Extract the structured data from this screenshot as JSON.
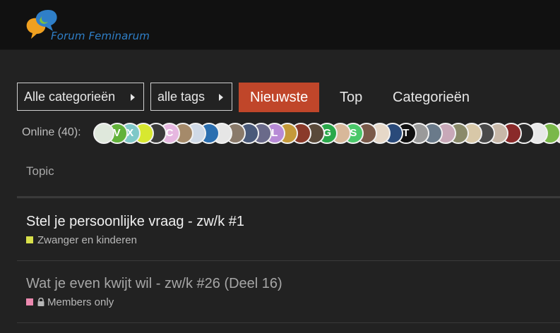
{
  "header": {
    "logo_text": "Forum Feminarum"
  },
  "nav": {
    "categories_dropdown": "Alle categorieën",
    "tags_dropdown": "alle tags",
    "tabs": [
      "Nieuwste",
      "Top",
      "Categorieën"
    ],
    "active_tab": "Nieuwste"
  },
  "online": {
    "label": "Online (40):",
    "avatars": [
      {
        "letter": "",
        "color": "#dfe8dc"
      },
      {
        "letter": "V",
        "color": "#62b23a"
      },
      {
        "letter": "X",
        "color": "#7fc8c8"
      },
      {
        "letter": "",
        "color": "#d8e830"
      },
      {
        "letter": "",
        "color": "#3b3b3b"
      },
      {
        "letter": "C",
        "color": "#e6b7e0"
      },
      {
        "letter": "",
        "color": "#a58a6a"
      },
      {
        "letter": "",
        "color": "#cfd9e6"
      },
      {
        "letter": "",
        "color": "#2b6fb0"
      },
      {
        "letter": "",
        "color": "#e6e6e6"
      },
      {
        "letter": "",
        "color": "#8a7a6a"
      },
      {
        "letter": "",
        "color": "#4a5a7a"
      },
      {
        "letter": "",
        "color": "#6a6a8a"
      },
      {
        "letter": "L",
        "color": "#b78ad6"
      },
      {
        "letter": "",
        "color": "#c59a3a"
      },
      {
        "letter": "",
        "color": "#8a3a2a"
      },
      {
        "letter": "",
        "color": "#5a4a3a"
      },
      {
        "letter": "G",
        "color": "#2aa84a"
      },
      {
        "letter": "",
        "color": "#d8b89a"
      },
      {
        "letter": "S",
        "color": "#4ac86a"
      },
      {
        "letter": "",
        "color": "#7a5a4a"
      },
      {
        "letter": "",
        "color": "#e6d8c8"
      },
      {
        "letter": "",
        "color": "#2a4a7a"
      },
      {
        "letter": "T",
        "color": "#111111"
      },
      {
        "letter": "",
        "color": "#9a9a9a"
      },
      {
        "letter": "",
        "color": "#6a7a8a"
      },
      {
        "letter": "",
        "color": "#c8a8b8"
      },
      {
        "letter": "",
        "color": "#8a8a6a"
      },
      {
        "letter": "",
        "color": "#d8c8a8"
      },
      {
        "letter": "",
        "color": "#4a4a4a"
      },
      {
        "letter": "",
        "color": "#c8b8a8"
      },
      {
        "letter": "",
        "color": "#8a2a2a"
      },
      {
        "letter": "",
        "color": "#2a2a2a"
      },
      {
        "letter": "",
        "color": "#e8e8e8"
      },
      {
        "letter": "",
        "color": "#7ab84a"
      },
      {
        "letter": "",
        "color": "#e8e0d0"
      }
    ]
  },
  "topic_list": {
    "header": "Topic",
    "rows": [
      {
        "title": "Stel je persoonlijke vraag - zw/k #1",
        "category": "Zwanger en kinderen",
        "color": "#d8e04a",
        "locked": false,
        "read": false
      },
      {
        "title": "Wat je even kwijt wil - zw/k #26 (Deel 16)",
        "category": "Members only",
        "color": "#ec8ab0",
        "locked": true,
        "read": true
      }
    ]
  }
}
